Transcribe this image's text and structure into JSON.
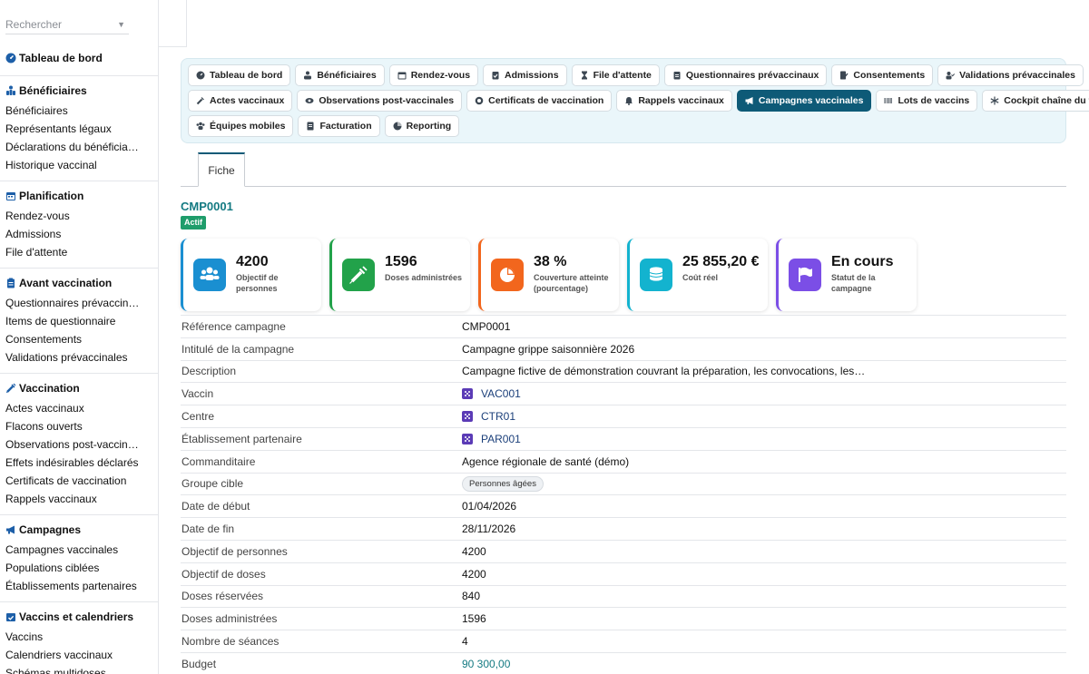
{
  "search": {
    "placeholder": "Rechercher"
  },
  "sidebar": {
    "dashboard": "Tableau de bord",
    "sections": [
      {
        "title": "Bénéficiaires",
        "icon": "users-tree-icon",
        "items": [
          "Bénéficiaires",
          "Représentants légaux",
          "Déclarations du bénéficia…",
          "Historique vaccinal"
        ]
      },
      {
        "title": "Planification",
        "icon": "calendar-icon",
        "items": [
          "Rendez-vous",
          "Admissions",
          "File d'attente"
        ]
      },
      {
        "title": "Avant vaccination",
        "icon": "clipboard-icon",
        "items": [
          "Questionnaires prévaccin…",
          "Items de questionnaire",
          "Consentements",
          "Validations prévaccinales"
        ]
      },
      {
        "title": "Vaccination",
        "icon": "syringe-icon",
        "items": [
          "Actes vaccinaux",
          "Flacons ouverts",
          "Observations post-vaccin…",
          "Effets indésirables déclarés",
          "Certificats de vaccination",
          "Rappels vaccinaux"
        ]
      },
      {
        "title": "Campagnes",
        "icon": "megaphone-icon",
        "items": [
          "Campagnes vaccinales",
          "Populations ciblées",
          "Établissements partenaires"
        ]
      },
      {
        "title": "Vaccins et calendriers",
        "icon": "calendar-check-icon",
        "items": [
          "Vaccins",
          "Calendriers vaccinaux",
          "Schémas multidoses"
        ]
      }
    ]
  },
  "nav": {
    "rows": [
      [
        "Tableau de bord",
        "Bénéficiaires",
        "Rendez-vous",
        "Admissions",
        "File d'attente",
        "Questionnaires prévaccinaux",
        "Consentements",
        "Validations prévaccinales"
      ],
      [
        "Actes vaccinaux",
        "Observations post-vaccinales",
        "Certificats de vaccination",
        "Rappels vaccinaux",
        "Campagnes vaccinales",
        "Lots de vaccins",
        "Cockpit chaîne du froid"
      ],
      [
        "Équipes mobiles",
        "Facturation",
        "Reporting"
      ]
    ],
    "active": "Campagnes vaccinales"
  },
  "tabs": {
    "fiche": "Fiche"
  },
  "record": {
    "code": "CMP0001",
    "status": "Actif"
  },
  "kpis": [
    {
      "value": "4200",
      "label": "Objectif de personnes",
      "color": "#1a8fd1",
      "icon": "users-icon"
    },
    {
      "value": "1596",
      "label": "Doses administrées",
      "color": "#22a24a",
      "icon": "syringe-icon"
    },
    {
      "value": "38 %",
      "label": "Couverture atteinte (pourcentage)",
      "color": "#f2661d",
      "icon": "pie-chart-icon"
    },
    {
      "value": "25 855,20 €",
      "label": "Coût réel",
      "color": "#13b3cf",
      "icon": "coins-icon"
    },
    {
      "value": "En cours",
      "label": "Statut de la campagne",
      "color": "#7b4ee6",
      "icon": "flag-icon"
    }
  ],
  "fields": [
    {
      "label": "Référence campagne",
      "value": "CMP0001",
      "kind": "text"
    },
    {
      "label": "Intitulé de la campagne",
      "value": "Campagne grippe saisonnière 2026",
      "kind": "text"
    },
    {
      "label": "Description",
      "value": "Campagne fictive de démonstration couvrant la préparation, les convocations, les…",
      "kind": "text"
    },
    {
      "label": "Vaccin",
      "value": "VAC001",
      "kind": "link"
    },
    {
      "label": "Centre",
      "value": "CTR01",
      "kind": "link"
    },
    {
      "label": "Établissement partenaire",
      "value": "PAR001",
      "kind": "link"
    },
    {
      "label": "Commanditaire",
      "value": "Agence régionale de santé (démo)",
      "kind": "text"
    },
    {
      "label": "Groupe cible",
      "value": "Personnes âgées",
      "kind": "tag"
    },
    {
      "label": "Date de début",
      "value": "01/04/2026",
      "kind": "text"
    },
    {
      "label": "Date de fin",
      "value": "28/11/2026",
      "kind": "text"
    },
    {
      "label": "Objectif de personnes",
      "value": "4200",
      "kind": "text"
    },
    {
      "label": "Objectif de doses",
      "value": "4200",
      "kind": "text"
    },
    {
      "label": "Doses réservées",
      "value": "840",
      "kind": "text"
    },
    {
      "label": "Doses administrées",
      "value": "1596",
      "kind": "text"
    },
    {
      "label": "Nombre de séances",
      "value": "4",
      "kind": "text"
    },
    {
      "label": "Budget",
      "value": "90 300,00",
      "kind": "money"
    }
  ]
}
